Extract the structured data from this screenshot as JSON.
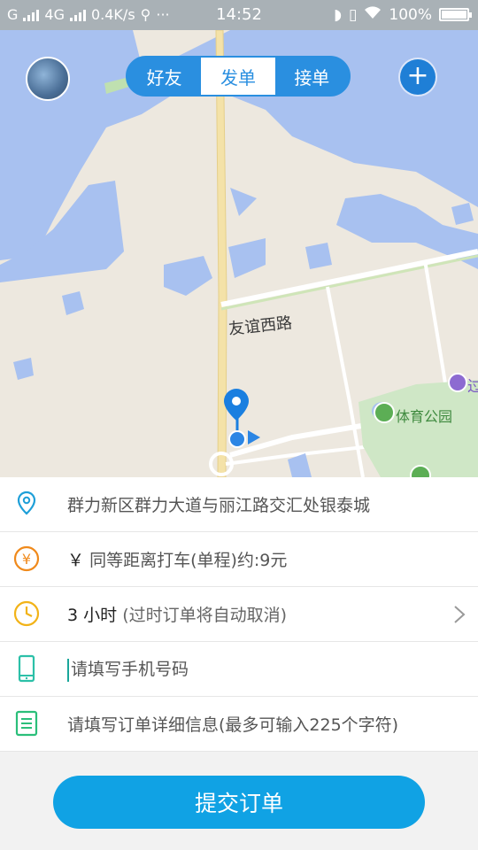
{
  "status_bar": {
    "carrier_left": "G",
    "network": "4G",
    "speed": "0.4K/s",
    "time": "14:52",
    "battery": "100%",
    "battery_level": 1.0
  },
  "map": {
    "road_label": "友谊西路",
    "park_label": "体育公园",
    "poi_partial_label": "过"
  },
  "header": {
    "tabs": [
      {
        "label": "好友",
        "active": false
      },
      {
        "label": "发单",
        "active": true
      },
      {
        "label": "接单",
        "active": false
      }
    ],
    "add_button": "+"
  },
  "form": {
    "address": "群力新区群力大道与丽江路交汇处银泰城",
    "price_symbol": "￥",
    "price_text": "同等距离打车(单程)约:9元",
    "duration_value": "3 小时",
    "duration_hint": "(过时订单将自动取消)",
    "phone_placeholder": "请填写手机号码",
    "details_placeholder": "请填写订单详细信息(最多可输入225个字符)"
  },
  "submit_label": "提交订单",
  "colors": {
    "accent": "#2a8fe0",
    "submit": "#10a2e4",
    "location_icon": "#1e9fd8",
    "price_icon": "#f08a1c",
    "clock_icon": "#f2b318",
    "phone_icon": "#2cc0a8",
    "doc_icon": "#2bbf7a"
  }
}
